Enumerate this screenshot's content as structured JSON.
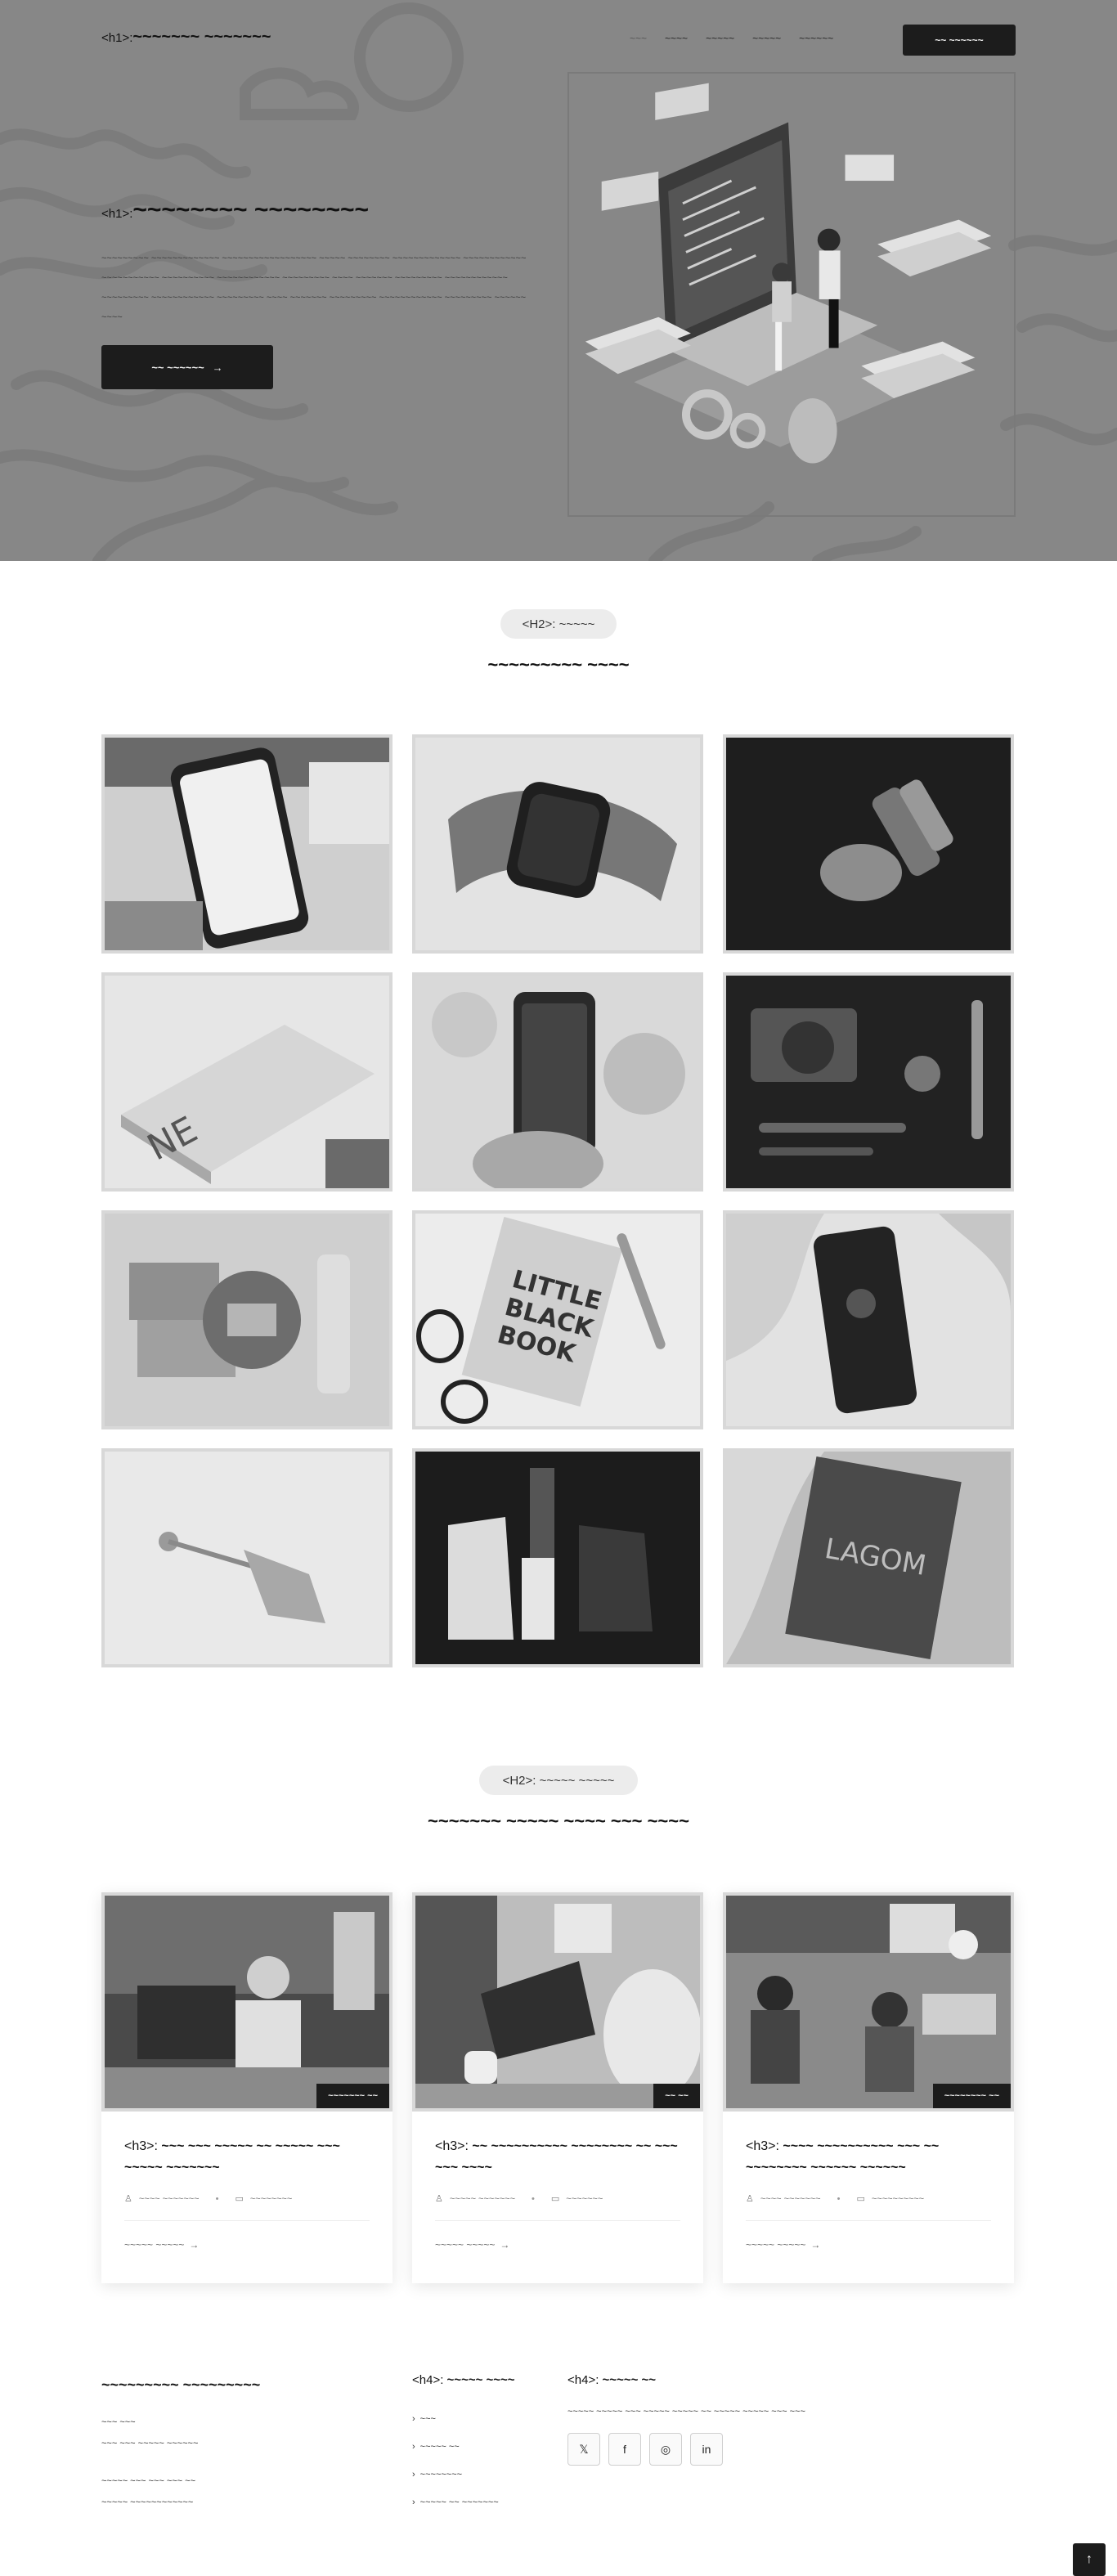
{
  "header": {
    "brand_tag": "<h1>:",
    "brand": "~~~~~~~ ~~~~~~~",
    "nav": [
      "~~~",
      "~~~~",
      "~~~~~",
      "~~~~~",
      "~~~~~~"
    ],
    "cta": "~~ ~~~~~~"
  },
  "hero": {
    "title_tag": "<h1>:",
    "title": "~~~~~~~~ ~~~~~~~~",
    "description": "~~~~~~~~~ ~~~~~~~~~~~~~ ~~~~~~~~~~~~~~~~~~ ~~~~~ ~~~~~~~~ ~~~~~~~~~~~~~ ~~~~~~~~~~~~ ~~~~~~~~~~~ ~~~~~~~~~~ ~~~~~~~~~~~~ ~~~~~~~~~ ~~~~ ~~~~~~~ ~~~~~~~~~ ~~~~~~~~~~~~ ~~~~~~~~~ ~~~~~~~~~~~~ ~~~~~~~~~ ~~~~ ~~~~~~~ ~~~~~~~~~ ~~~~~~~~~~~~ ~~~~~~~~~ ~~~~~~ ~~~~",
    "button": "~~ ~~~~~~",
    "button_icon": "arrow-right-icon"
  },
  "portfolio": {
    "pill_tag": "<H2>:",
    "pill": "~~~~~",
    "title": "~~~~~~~~~ ~~~~"
  },
  "blog": {
    "pill_tag": "<H2>:",
    "pill": "~~~~~ ~~~~~",
    "title": "~~~~~~~ ~~~~~ ~~~~ ~~~ ~~~~",
    "posts": [
      {
        "date": "~~~~~~~ ~~",
        "title_tag": "<h3>:",
        "title": "~~~ ~~~ ~~~~~ ~~ ~~~~~ ~~~ ~~~~~ ~~~~~~~",
        "author": "~~~~ ~~~~~~~",
        "category": "~~~~~~~~",
        "more": "~~~~~ ~~~~~"
      },
      {
        "date": "~~ ~~",
        "title_tag": "<h3>:",
        "title": "~~ ~~~~~~~~~~ ~~~~~~~~ ~~ ~~~ ~~~ ~~~~",
        "author": "~~~~~ ~~~~~~~",
        "category": "~~~~~~~",
        "more": "~~~~~ ~~~~~"
      },
      {
        "date": "~~~~~~~~ ~~",
        "title_tag": "<h3>:",
        "title": "~~~~ ~~~~~~~~~~ ~~~ ~~ ~~~~~~~~ ~~~~~~ ~~~~~~",
        "author": "~~~~ ~~~~~~~",
        "category": "~~~~~~~~~~",
        "more": "~~~~~ ~~~~~"
      }
    ]
  },
  "footer": {
    "brand": "~~~~~~~~~ ~~~~~~~~~",
    "address_line1": "~~~ ~~~",
    "address_line2": "~~~ ~~~ ~~~~~ ~~~~~~",
    "contact_line1": "~~~~~ ~~~ ~~~ ~~~ ~~",
    "contact_line2": "~~~~~ ~~~~~~~~~~~~",
    "links_tag": "<h4>:",
    "links_title": "~~~~~ ~~~~",
    "links": [
      "~~~",
      "~~~~~ ~~",
      "~~~~~~~~",
      "~~~~~ ~~ ~~~~~~~"
    ],
    "follow_tag": "<h4>:",
    "follow_title": "~~~~~ ~~",
    "follow_text": "~~~~~ ~~~~~ ~~~ ~~~~~ ~~~~~ ~~ ~~~~~ ~~~~~ ~~~ ~~~",
    "socials": [
      "x-icon",
      "facebook-icon",
      "instagram-icon",
      "linkedin-icon"
    ]
  },
  "back_to_top_icon": "arrow-up-icon"
}
